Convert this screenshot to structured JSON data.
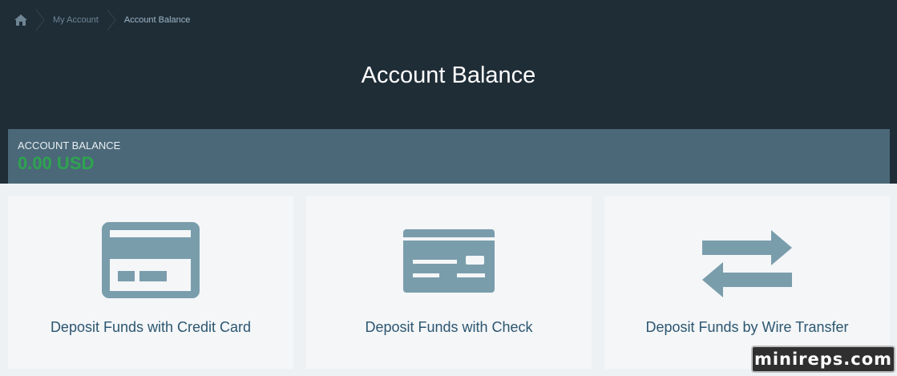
{
  "breadcrumb": {
    "items": [
      {
        "label": "My Account"
      },
      {
        "label": "Account Balance"
      }
    ]
  },
  "page": {
    "title": "Account Balance"
  },
  "balance": {
    "label": "ACCOUNT BALANCE",
    "value": "0.00 USD",
    "value_color": "#2ea44f"
  },
  "cards": [
    {
      "label": "Deposit Funds with Credit Card",
      "icon": "credit-card-icon"
    },
    {
      "label": "Deposit Funds with Check",
      "icon": "check-icon"
    },
    {
      "label": "Deposit Funds by Wire Transfer",
      "icon": "transfer-arrows-icon"
    }
  ],
  "watermark": {
    "text": "minireps.com"
  },
  "colors": {
    "hero_bg": "#1f2d37",
    "balance_bg": "#4a6878",
    "card_bg": "#f4f6f8",
    "icon": "#7a9dac",
    "card_text": "#2c5670"
  }
}
